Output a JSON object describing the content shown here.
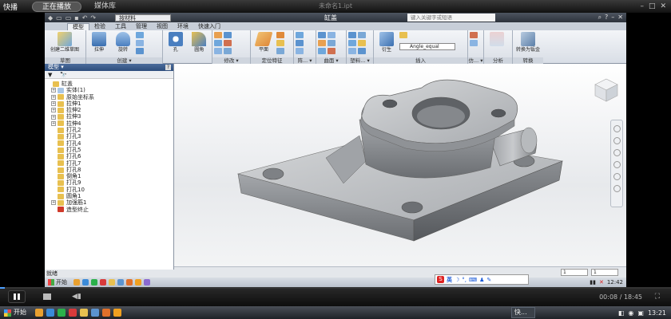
{
  "player": {
    "logo": "快播",
    "tabs": [
      "正在播放",
      "媒体库"
    ],
    "title": "未命名1.ipt",
    "time_elapsed": "00:08",
    "time_total": "18:45",
    "progress": 0.007,
    "window_controls": [
      "–",
      "□",
      "✕"
    ]
  },
  "app": {
    "qat_material": "按材料",
    "title": "缸盖",
    "help_search": "键入关键字或短语",
    "ribbon_tabs": [
      "模型",
      "检验",
      "工具",
      "管理",
      "视图",
      "环境",
      "快速入门"
    ],
    "active_tab": "模型",
    "groups": [
      {
        "label": "草图",
        "buttons": [
          "创建二维草图"
        ]
      },
      {
        "label": "创建 ▾",
        "buttons": [
          "拉伸",
          "旋转"
        ]
      },
      {
        "label": "",
        "buttons": [
          "孔",
          "圆角"
        ]
      },
      {
        "label": "修改 ▾",
        "buttons": []
      },
      {
        "label": "定位特征",
        "buttons": [
          "平面"
        ]
      },
      {
        "label": "阵... ▾",
        "buttons": []
      },
      {
        "label": "曲面 ▾",
        "buttons": []
      },
      {
        "label": "塑料... ▾",
        "buttons": []
      },
      {
        "label": "插入",
        "buttons": [
          "衍生"
        ]
      },
      {
        "label": "仿... ▾",
        "buttons": []
      },
      {
        "label": "分析",
        "buttons": []
      },
      {
        "label": "转换",
        "buttons": [
          "转换为钣金"
        ]
      }
    ],
    "angle_select": "Angle_equal",
    "browser": {
      "title": "模型 ▾",
      "close": "?",
      "toolbar": [
        "▼",
        "🔭"
      ],
      "tree": [
        {
          "label": "缸盖",
          "level": 0,
          "expand": "",
          "color": "#e8c050"
        },
        {
          "label": "实体(1)",
          "level": 1,
          "expand": "+",
          "color": "#a9c7e6"
        },
        {
          "label": "原始坐标系",
          "level": 1,
          "expand": "+",
          "color": "#e8c050"
        },
        {
          "label": "拉伸1",
          "level": 1,
          "expand": "+",
          "color": "#e8c050"
        },
        {
          "label": "拉伸2",
          "level": 1,
          "expand": "+",
          "color": "#e8c050"
        },
        {
          "label": "拉伸3",
          "level": 1,
          "expand": "+",
          "color": "#e8c050"
        },
        {
          "label": "拉伸4",
          "level": 1,
          "expand": "+",
          "color": "#e8c050"
        },
        {
          "label": "打孔2",
          "level": 1,
          "expand": "",
          "color": "#e8c050"
        },
        {
          "label": "打孔3",
          "level": 1,
          "expand": "",
          "color": "#e8c050"
        },
        {
          "label": "打孔4",
          "level": 1,
          "expand": "",
          "color": "#e8c050"
        },
        {
          "label": "打孔5",
          "level": 1,
          "expand": "",
          "color": "#e8c050"
        },
        {
          "label": "打孔6",
          "level": 1,
          "expand": "",
          "color": "#e8c050"
        },
        {
          "label": "打孔7",
          "level": 1,
          "expand": "",
          "color": "#e8c050"
        },
        {
          "label": "打孔8",
          "level": 1,
          "expand": "",
          "color": "#e8c050"
        },
        {
          "label": "倒角1",
          "level": 1,
          "expand": "",
          "color": "#e8c050"
        },
        {
          "label": "打孔9",
          "level": 1,
          "expand": "",
          "color": "#e8c050"
        },
        {
          "label": "打孔10",
          "level": 1,
          "expand": "",
          "color": "#e8c050"
        },
        {
          "label": "圆角1",
          "level": 1,
          "expand": "",
          "color": "#e8c050"
        },
        {
          "label": "加强筋1",
          "level": 1,
          "expand": "+",
          "color": "#e8c050"
        },
        {
          "label": "造型终止",
          "level": 1,
          "expand": "",
          "color": "#d03a2a"
        }
      ]
    },
    "status_text": "就绪",
    "page_fields": [
      "1",
      "1"
    ],
    "inner_taskbar": {
      "start": "开始",
      "clock": "12:42",
      "ime_lang": "英"
    }
  },
  "os_taskbar": {
    "start": "开始",
    "task": "快...",
    "clock": "13:21"
  }
}
